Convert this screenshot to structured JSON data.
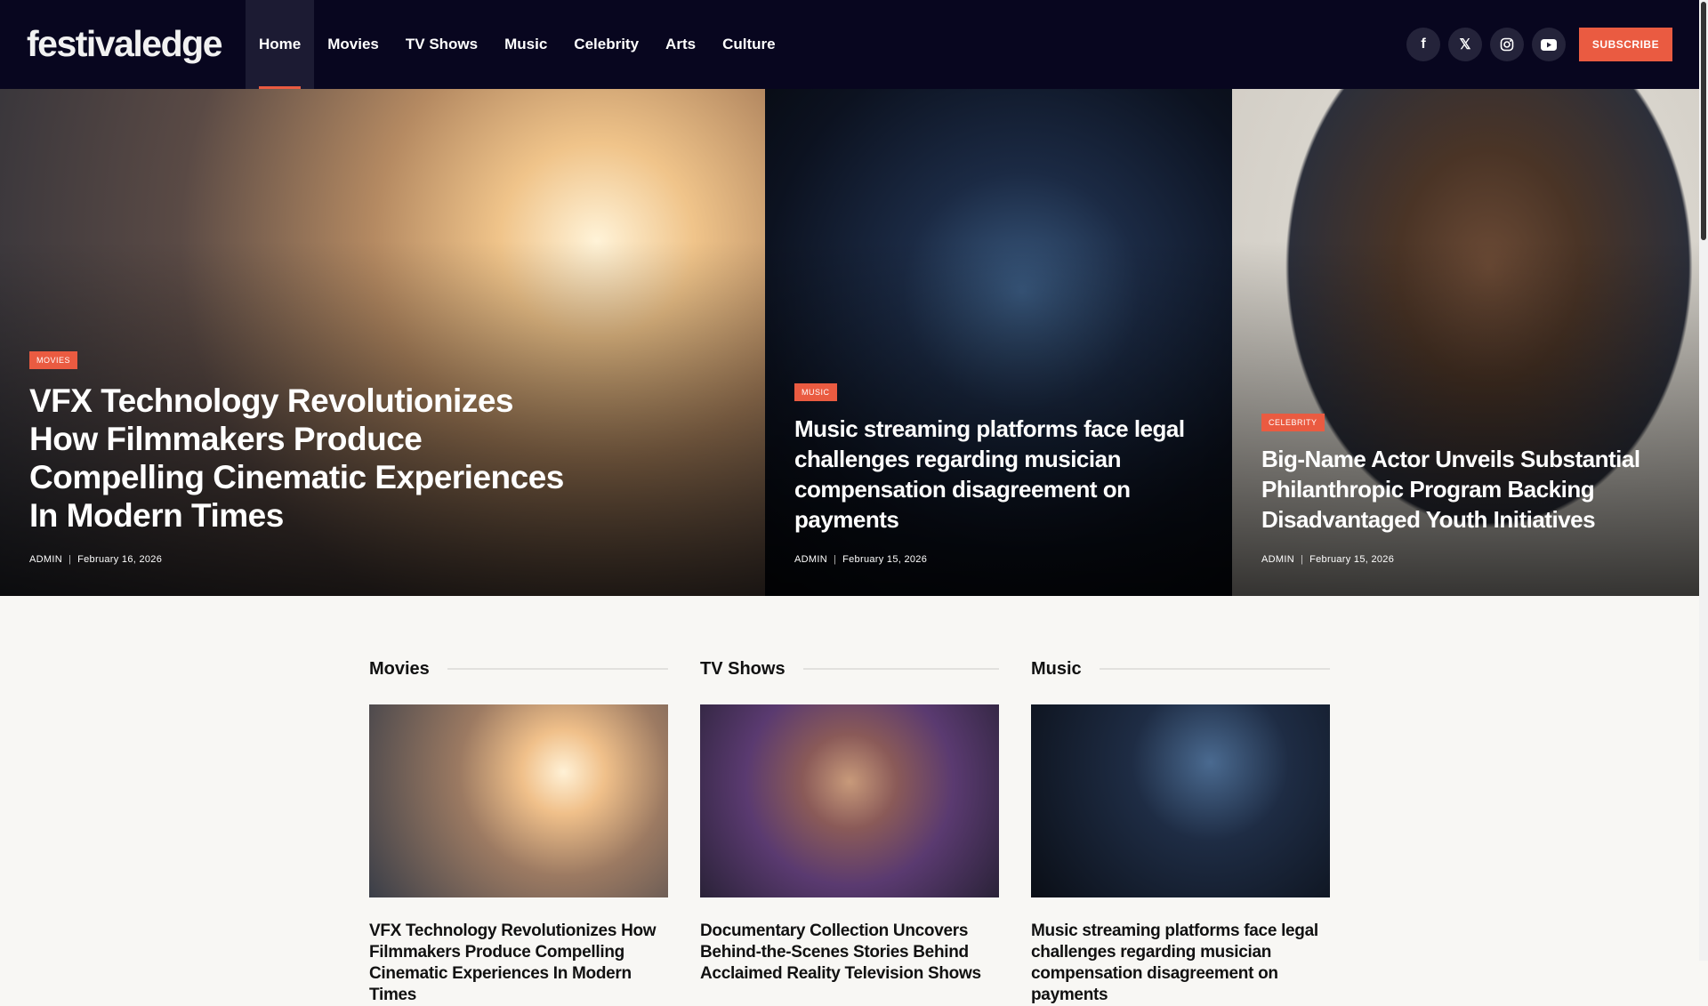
{
  "header": {
    "logo": "festivaledge",
    "nav": [
      "Home",
      "Movies",
      "TV Shows",
      "Music",
      "Celebrity",
      "Arts",
      "Culture"
    ],
    "active": "Home",
    "social": [
      "facebook-icon",
      "x-icon",
      "instagram-icon",
      "youtube-icon"
    ],
    "subscribe": "SUBSCRIBE"
  },
  "hero": [
    {
      "category": "MOVIES",
      "title": "VFX Technology Revolutionizes How Filmmakers Produce Compelling Cinematic Experiences In Modern Times",
      "author": "ADMIN",
      "date": "February 16, 2026"
    },
    {
      "category": "MUSIC",
      "title": "Music streaming platforms face legal challenges regarding musician compensation disagreement on payments",
      "author": "ADMIN",
      "date": "February 15, 2026"
    },
    {
      "category": "CELEBRITY",
      "title": "Big-Name Actor Unveils Substantial Philanthropic Program Backing Disadvantaged Youth Initiatives",
      "author": "ADMIN",
      "date": "February 15, 2026"
    }
  ],
  "sections": [
    {
      "heading": "Movies",
      "title": "VFX Technology Revolutionizes How Filmmakers Produce Compelling Cinematic Experiences In Modern Times"
    },
    {
      "heading": "TV Shows",
      "title": "Documentary Collection Uncovers Behind-the-Scenes Stories Behind Acclaimed Reality Television Shows"
    },
    {
      "heading": "Music",
      "title": "Music streaming platforms face legal challenges regarding musician compensation disagreement on payments"
    }
  ],
  "colors": {
    "header_bg": "#08061f",
    "accent": "#ea5b41",
    "page_bg": "#f8f7f4"
  }
}
